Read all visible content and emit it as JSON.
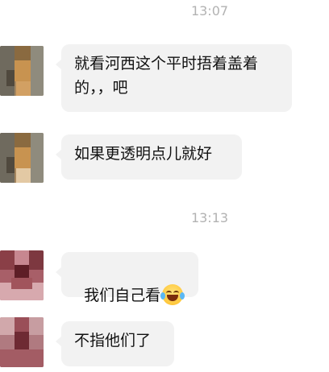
{
  "chat": {
    "timestamps": [
      "13:07",
      "13:13"
    ],
    "messages": [
      {
        "sender": "contact-1",
        "text": "就看河西这个平时捂着盖着\n的，，吧"
      },
      {
        "sender": "contact-1",
        "text": "如果更透明点儿就好"
      },
      {
        "sender": "contact-2",
        "text": "我们自己看",
        "emoji": "grinning-squinting-tears-emoji"
      },
      {
        "sender": "contact-2",
        "text": "不指他们了"
      }
    ]
  }
}
